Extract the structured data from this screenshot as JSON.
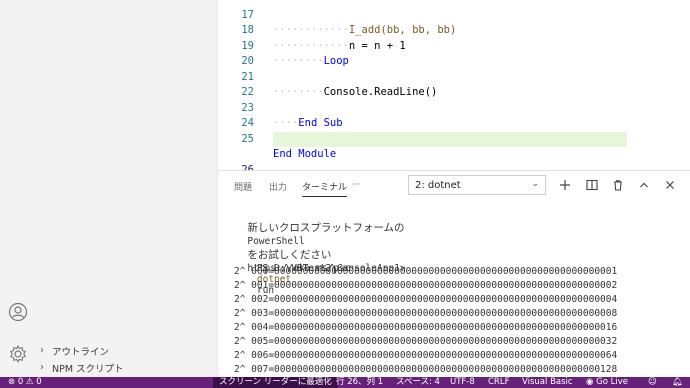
{
  "sidebar": {
    "sections": [
      {
        "label": "アウトライン"
      },
      {
        "label": "NPM スクリプト"
      }
    ]
  },
  "editor": {
    "lines": [
      {
        "n": "17",
        "indent": "············",
        "text": "I_add(bb, bb, bb)"
      },
      {
        "n": "18",
        "indent": "············",
        "text": "n = n + 1"
      },
      {
        "n": "19",
        "indent": "········",
        "text": "Loop"
      },
      {
        "n": "20",
        "indent": "",
        "text": ""
      },
      {
        "n": "21",
        "indent": "········",
        "text": "Console.ReadLine()"
      },
      {
        "n": "22",
        "indent": "",
        "text": ""
      },
      {
        "n": "23",
        "indent": "····",
        "text": "End Sub"
      },
      {
        "n": "24",
        "indent": "",
        "text": ""
      },
      {
        "n": "25",
        "indent": "",
        "text": "End Module"
      },
      {
        "n": "26",
        "indent": "",
        "text": ""
      }
    ]
  },
  "panel": {
    "tabs": [
      "問題",
      "出力",
      "ターミナル",
      "···"
    ],
    "active_tab": "ターミナル",
    "terminal_select": "2: dotnet",
    "toolbar_icons": [
      "add-terminal-icon",
      "split-terminal-icon",
      "trash-icon",
      "maximize-panel-icon",
      "close-panel-icon"
    ]
  },
  "terminal": {
    "banner_jp1": "新しいクロスプラットフォームの",
    "banner_ps": "PowerShell",
    "banner_jp2": "をお試しください",
    "banner_url": "https://aka.ms/psc",
    "prompt": "PS D:\\VBTest2\\ConsoleApp1>",
    "command": "dotnet",
    "command_arg": "run",
    "output": [
      "2^ 000=000000000000000000000000000000000000000000000000000000000001",
      "2^ 001=000000000000000000000000000000000000000000000000000000000002",
      "2^ 002=000000000000000000000000000000000000000000000000000000000004",
      "2^ 003=000000000000000000000000000000000000000000000000000000000008",
      "2^ 004=000000000000000000000000000000000000000000000000000000000016",
      "2^ 005=000000000000000000000000000000000000000000000000000000000032",
      "2^ 006=000000000000000000000000000000000000000000000000000000000064",
      "2^ 007=000000000000000000000000000000000000000000000000000000000128"
    ]
  },
  "statusbar": {
    "problems": "⊗ 0 ⚠ 0",
    "screen_reader": "スクリーン リーダーに最適化",
    "position": "行 26、列 1",
    "spaces": "スペース: 4",
    "encoding": "UTF-8",
    "eol": "CRLF",
    "language": "Visual Basic",
    "golive": "◉ Go Live",
    "colors": {
      "background": "#68217a",
      "highlight": "#3b0f4a"
    }
  }
}
